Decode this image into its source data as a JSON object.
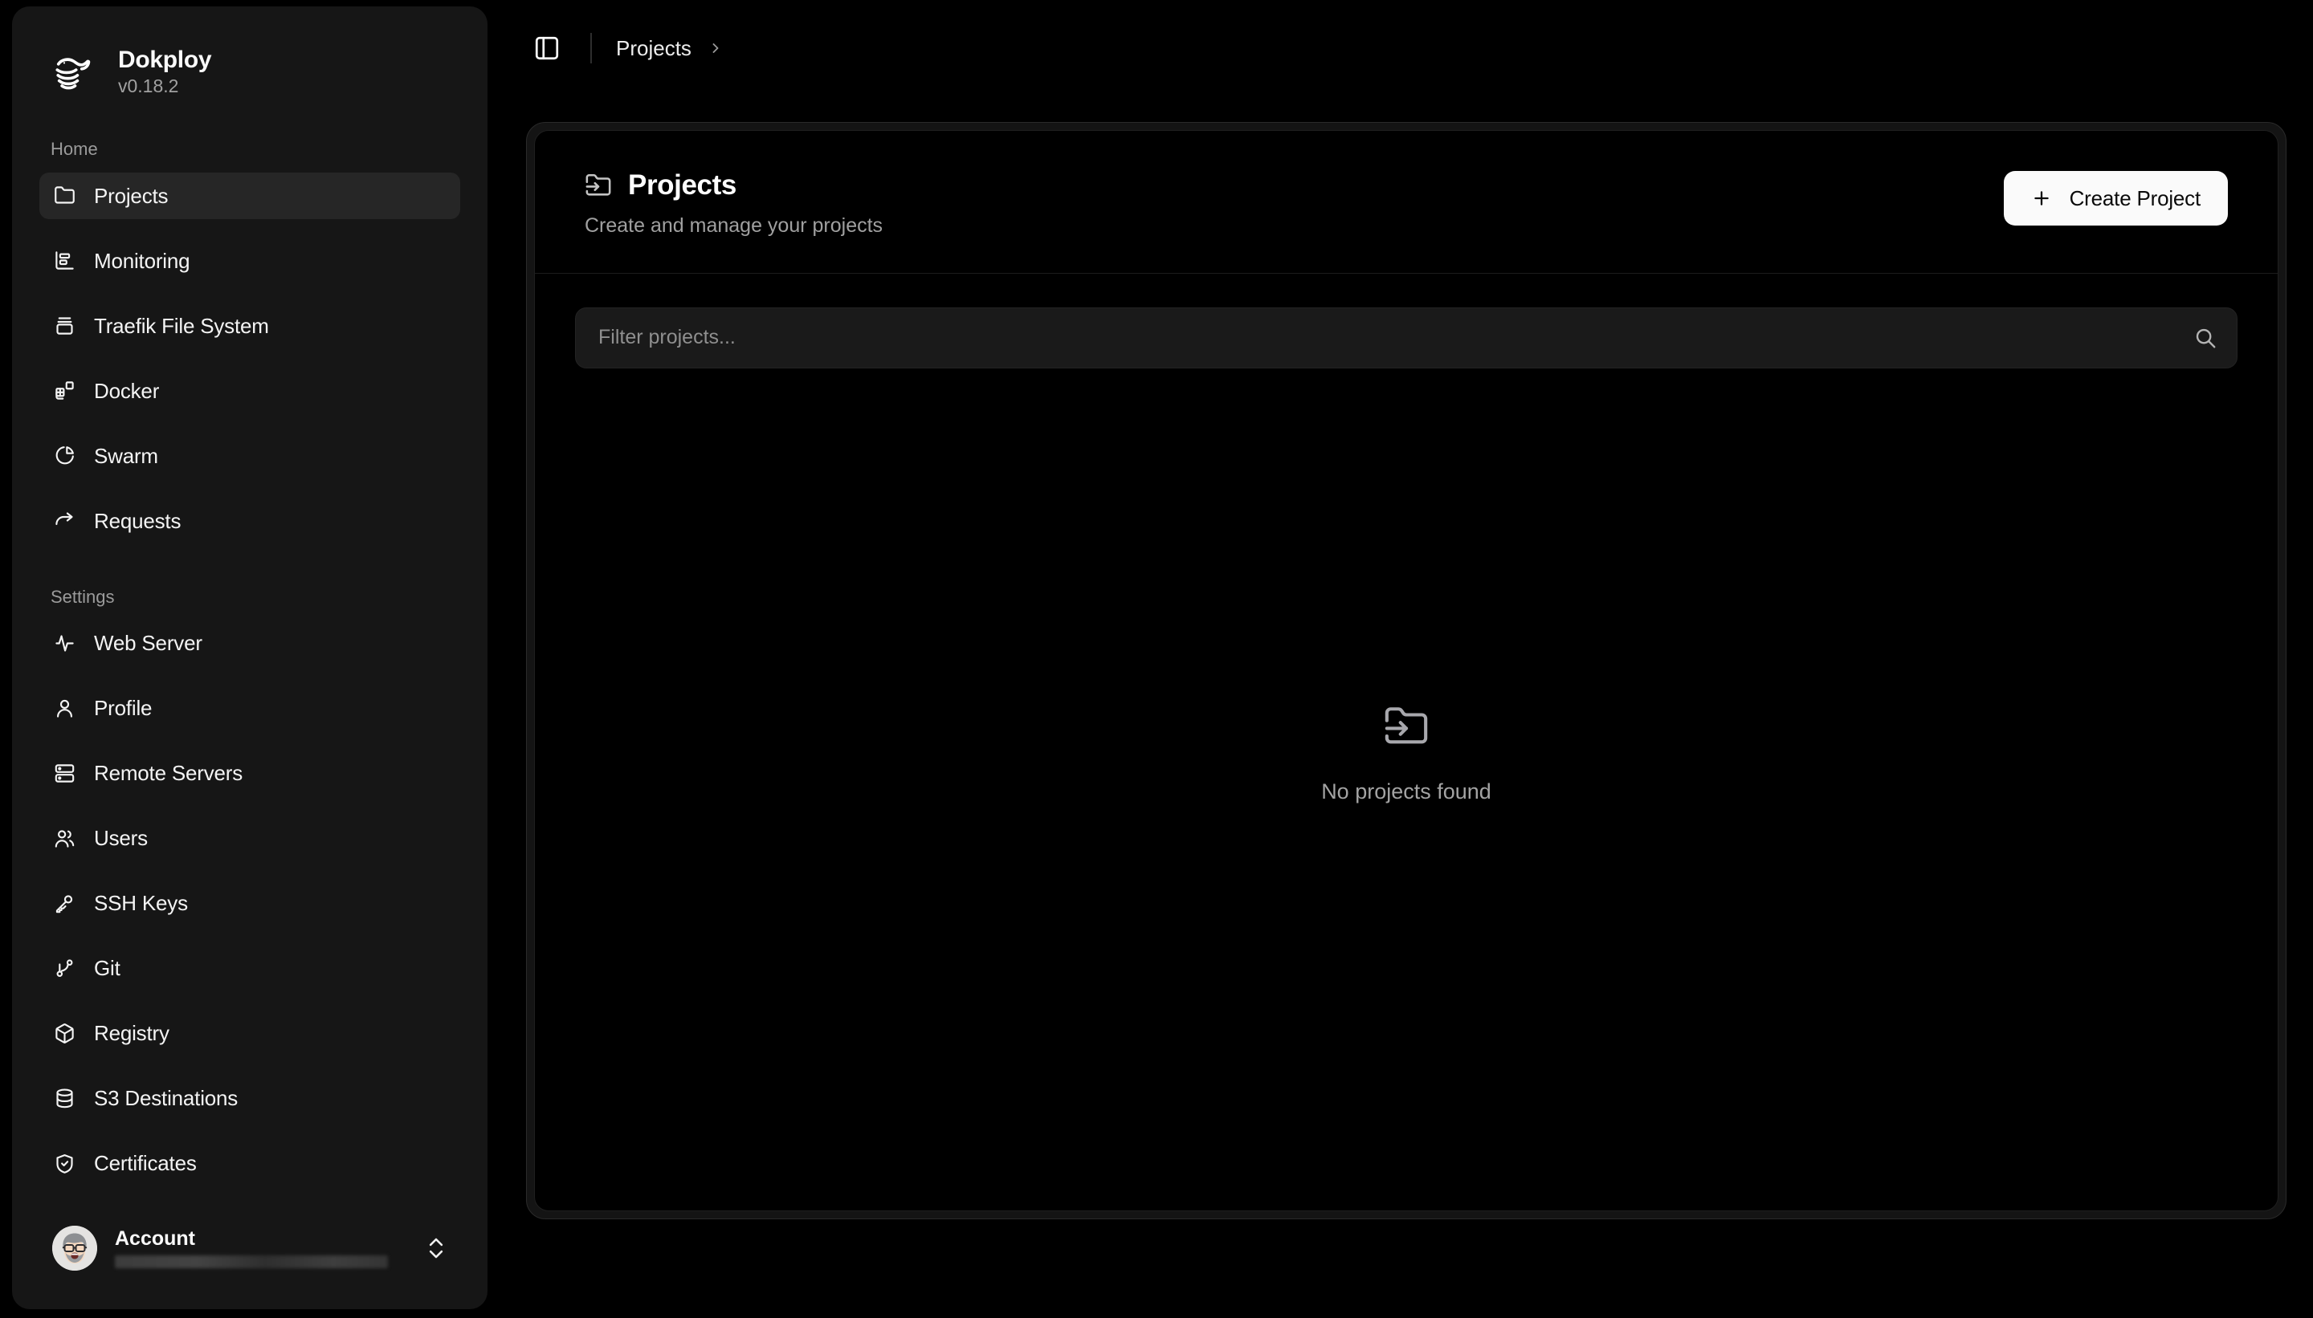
{
  "brand": {
    "name": "Dokploy",
    "version": "v0.18.2",
    "logo_icon": "whale-logo-icon"
  },
  "sidebar": {
    "groups": [
      {
        "label": "Home",
        "items": [
          {
            "label": "Projects",
            "icon": "folder-icon",
            "active": true
          },
          {
            "label": "Monitoring",
            "icon": "chart-bar-icon",
            "active": false
          },
          {
            "label": "Traefik File System",
            "icon": "database-icon",
            "active": false
          },
          {
            "label": "Docker",
            "icon": "blocks-icon",
            "active": false
          },
          {
            "label": "Swarm",
            "icon": "pie-chart-icon",
            "active": false
          },
          {
            "label": "Requests",
            "icon": "forward-arrow-icon",
            "active": false
          }
        ]
      },
      {
        "label": "Settings",
        "items": [
          {
            "label": "Web Server",
            "icon": "activity-pulse-icon",
            "active": false
          },
          {
            "label": "Profile",
            "icon": "user-icon",
            "active": false
          },
          {
            "label": "Remote Servers",
            "icon": "server-rack-icon",
            "active": false
          },
          {
            "label": "Users",
            "icon": "users-icon",
            "active": false
          },
          {
            "label": "SSH Keys",
            "icon": "key-icon",
            "active": false
          },
          {
            "label": "Git",
            "icon": "git-branch-icon",
            "active": false
          },
          {
            "label": "Registry",
            "icon": "package-box-icon",
            "active": false
          },
          {
            "label": "S3 Destinations",
            "icon": "database-stack-icon",
            "active": false
          },
          {
            "label": "Certificates",
            "icon": "shield-check-icon",
            "active": false
          }
        ]
      }
    ],
    "account": {
      "name": "Account",
      "email": "",
      "email_redacted": true,
      "avatar_icon": "user-avatar",
      "expand_icon": "chevrons-up-down-icon"
    }
  },
  "topbar": {
    "toggle_icon": "panel-left-icon",
    "breadcrumb": [
      {
        "label": "Projects"
      }
    ],
    "separator_icon": "chevron-right-icon"
  },
  "main": {
    "title": "Projects",
    "title_icon": "folder-input-icon",
    "subtitle": "Create and manage your projects",
    "create_button": {
      "label": "Create Project",
      "icon": "plus-icon"
    },
    "filter": {
      "placeholder": "Filter projects...",
      "value": "",
      "icon": "search-icon"
    },
    "empty_state": {
      "icon": "folder-input-icon",
      "text": "No projects found"
    }
  },
  "colors": {
    "page_background": "#000000",
    "sidebar_background": "#161616",
    "active_item_background": "#262626",
    "panel_outer": "#141414",
    "panel_border": "#2a2a2a",
    "card_background": "#000000",
    "input_background": "#1a1a1a",
    "accent_button": "#fafafa",
    "text_primary": "#fafafa",
    "text_muted": "#a1a1a1"
  }
}
